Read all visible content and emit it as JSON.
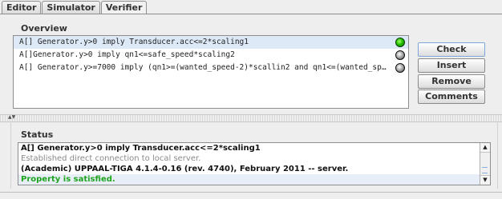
{
  "tabs": [
    "Editor",
    "Simulator",
    "Verifier"
  ],
  "active_tab": "Verifier",
  "overview": {
    "title": "Overview",
    "queries": [
      {
        "text": "A[] Generator.y>0 imply Transducer.acc<=2*scaling1",
        "status": "green",
        "selected": true
      },
      {
        "text": "A[]Generator.y>0 imply qn1<=safe_speed*scaling2",
        "status": "gray",
        "selected": false
      },
      {
        "text": "A[] Generator.y>=7000 imply (qn1>=(wanted_speed-2)*scallin2 and qn1<=(wanted_speed+...",
        "status": "gray",
        "selected": false
      }
    ]
  },
  "buttons": {
    "check": "Check",
    "insert": "Insert",
    "remove": "Remove",
    "comments": "Comments"
  },
  "divider_arrows": "▲▼",
  "status": {
    "title": "Status",
    "lines": [
      "A[] Generator.y>0 imply Transducer.acc<=2*scaling1",
      "Established direct connection to local server.",
      "(Academic) UPPAAL-TIGA 4.1.4-0.16 (rev. 4740), February 2011 -- server.",
      "Property is satisfied."
    ],
    "scroll_up": "▲",
    "scroll_down": "▼"
  }
}
